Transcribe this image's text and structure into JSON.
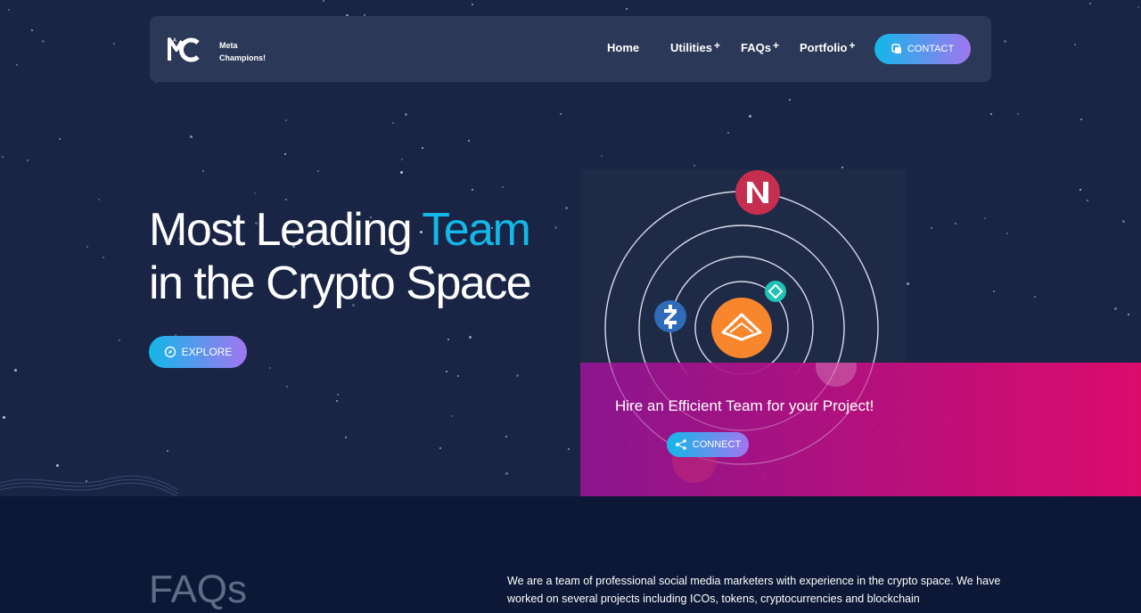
{
  "brand": {
    "line1": "Meta",
    "line2": "Champions!"
  },
  "nav": {
    "items": [
      {
        "label": "Home",
        "plus": ""
      },
      {
        "label": "Utilities",
        "plus": "+"
      },
      {
        "label": "FAQs",
        "plus": "+"
      },
      {
        "label": "Portfolio",
        "plus": "+"
      }
    ],
    "contact_label": "CONTACT"
  },
  "hero": {
    "headline_part1": "Most Leading ",
    "headline_accent": "Team",
    "headline_line2": "in the Crypto Space",
    "explore_label": "EXPLORE"
  },
  "hire": {
    "title": "Hire an Efficient Team for your Project!",
    "connect_label": "CONNECT"
  },
  "faq": {
    "title": "FAQs",
    "text": "We are a team of professional social media marketers with experience in the crypto space. We have worked on several projects including ICOs, tokens, cryptocurrencies and blockchain"
  },
  "colors": {
    "accent": "#13b7e8",
    "gradient_start": "#13b7e8",
    "gradient_end": "#a176f0",
    "hire_start": "#96149a",
    "hire_end": "#e60a6e"
  },
  "icons": [
    "logo-mc",
    "contact-icon",
    "explore-icon",
    "connect-icon",
    "coin-n",
    "coin-z",
    "coin-center",
    "coin-small",
    "coin-pink"
  ]
}
